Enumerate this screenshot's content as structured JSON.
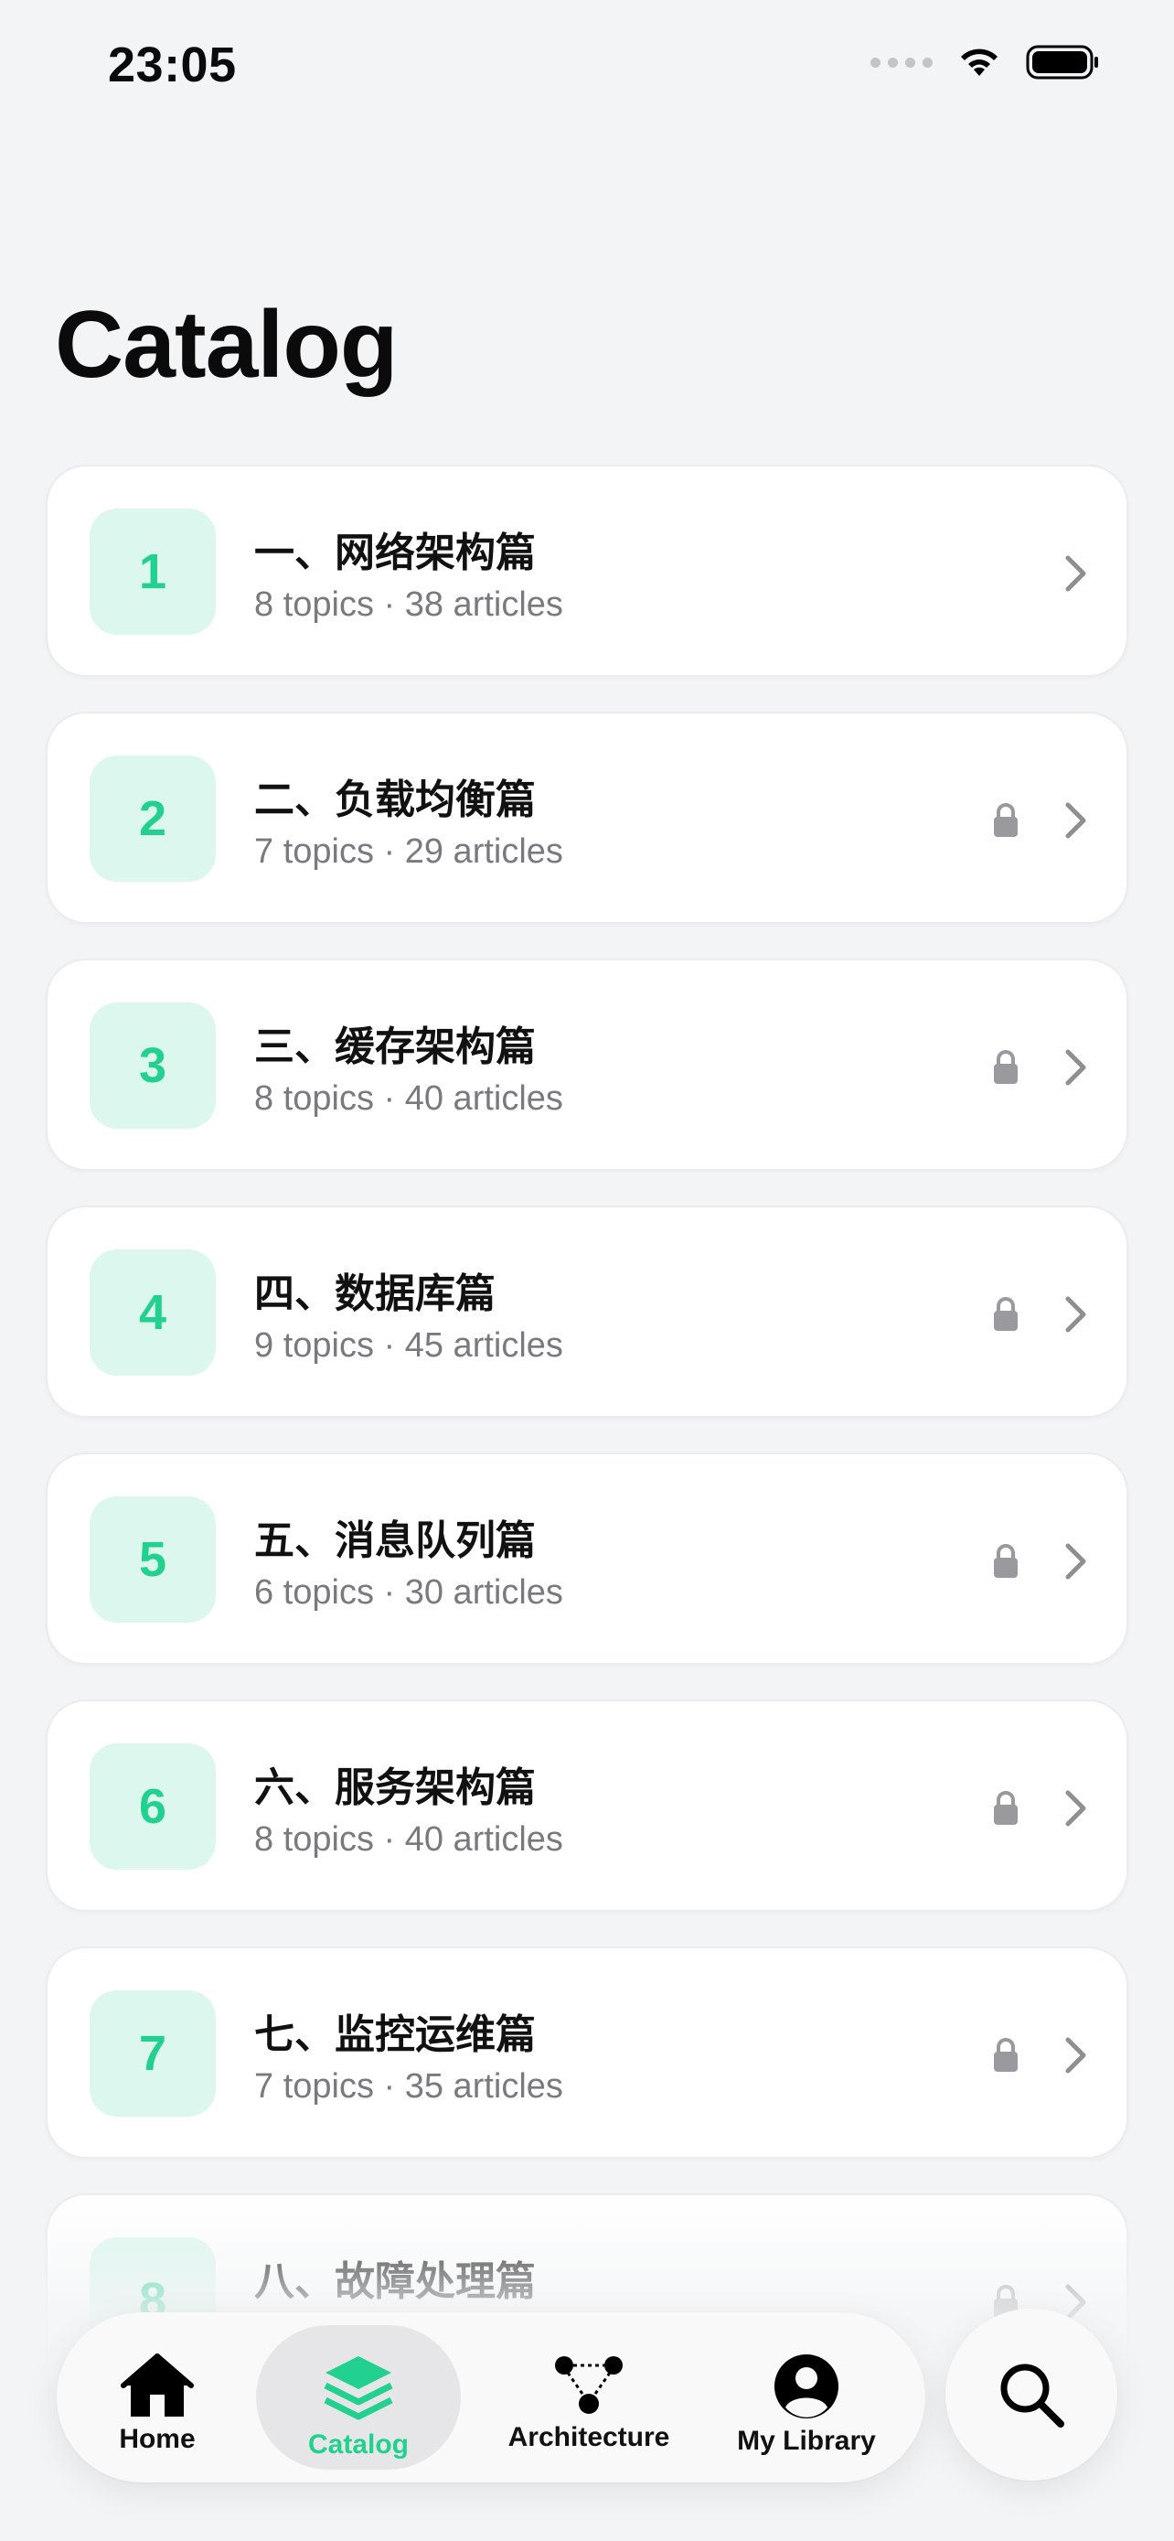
{
  "status_bar": {
    "time": "23:05"
  },
  "page": {
    "title": "Catalog"
  },
  "catalog": [
    {
      "number": "1",
      "title": "一、网络架构篇",
      "subtitle": "8 topics · 38 articles",
      "locked": false
    },
    {
      "number": "2",
      "title": "二、负载均衡篇",
      "subtitle": "7 topics · 29 articles",
      "locked": true
    },
    {
      "number": "3",
      "title": "三、缓存架构篇",
      "subtitle": "8 topics · 40 articles",
      "locked": true
    },
    {
      "number": "4",
      "title": "四、数据库篇",
      "subtitle": "9 topics · 45 articles",
      "locked": true
    },
    {
      "number": "5",
      "title": "五、消息队列篇",
      "subtitle": "6 topics · 30 articles",
      "locked": true
    },
    {
      "number": "6",
      "title": "六、服务架构篇",
      "subtitle": "8 topics · 40 articles",
      "locked": true
    },
    {
      "number": "7",
      "title": "七、监控运维篇",
      "subtitle": "7 topics · 35 articles",
      "locked": true
    },
    {
      "number": "8",
      "title": "八、故障处理篇",
      "subtitle": "",
      "locked": true
    }
  ],
  "tabbar": {
    "tabs": [
      {
        "label": "Home",
        "icon": "home-icon",
        "active": false
      },
      {
        "label": "Catalog",
        "icon": "layers-icon",
        "active": true
      },
      {
        "label": "Architecture",
        "icon": "nodes-icon",
        "active": false
      },
      {
        "label": "My Library",
        "icon": "person-icon",
        "active": false
      }
    ],
    "search_icon": "search-icon"
  },
  "colors": {
    "accent": "#22d18f",
    "accent_bg": "#dcf8ee",
    "background": "#f3f4f6"
  }
}
